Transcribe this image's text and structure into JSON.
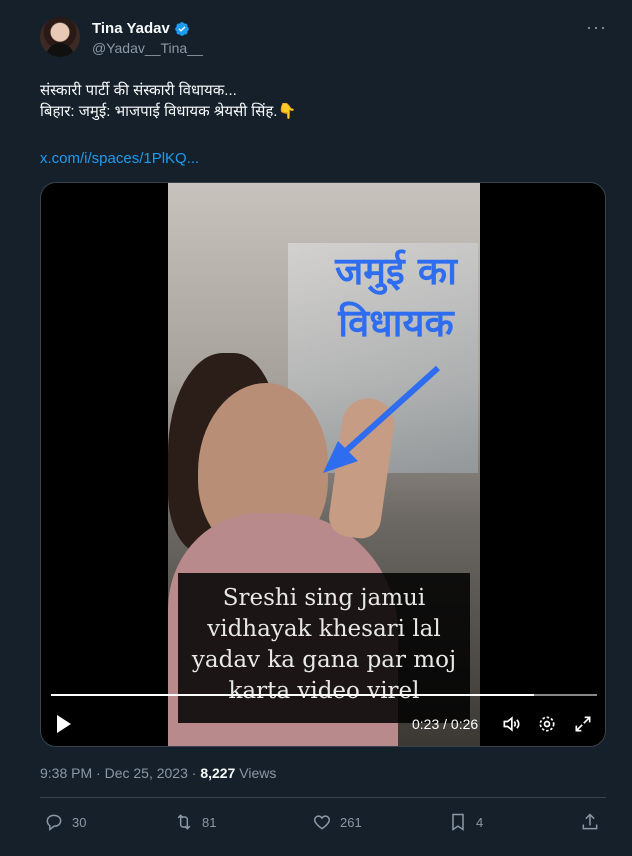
{
  "author": {
    "name": "Tina Yadav",
    "handle": "@Yadav__Tina__",
    "verified": true
  },
  "tweet": {
    "text": "संस्कारी पार्टी की संस्कारी विधायक...\nबिहार: जमुई: भाजपाई विधायक श्रेयसी सिंह.👇",
    "link": "x.com/i/spaces/1PlKQ..."
  },
  "video": {
    "overlay_title": "जमुई का विधायक",
    "caption": "Sreshi sing jamui vidhayak khesari lal yadav ka gana par moj karta video virel",
    "time": "0:23 / 0:26",
    "progress": 0.885
  },
  "meta": {
    "time": "9:38 PM · Dec 25, 2023 · ",
    "views_count": "8,227",
    "views_label": " Views"
  },
  "actions": {
    "replies": "30",
    "reposts": "81",
    "likes": "261",
    "bookmarks": "4"
  },
  "colors": {
    "background": "#15202b",
    "accent": "#1d9bf0",
    "muted": "#8b98a5"
  }
}
